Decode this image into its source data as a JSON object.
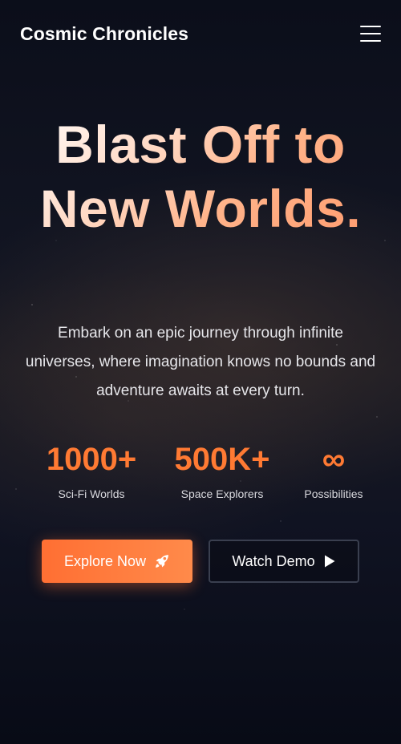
{
  "header": {
    "brand": "Cosmic Chronicles",
    "menu_icon": "hamburger-menu-icon"
  },
  "hero": {
    "title": "Blast Off to New Worlds.",
    "subtitle": "Embark on an epic journey through infinite universes, where imagination knows no bounds and adventure awaits at every turn."
  },
  "stats": [
    {
      "value": "1000+",
      "label": "Sci-Fi Worlds"
    },
    {
      "value": "500K+",
      "label": "Space Explorers"
    },
    {
      "value": "∞",
      "label": "Possibilities"
    }
  ],
  "actions": {
    "primary_label": "Explore Now",
    "primary_icon": "rocket-icon",
    "secondary_label": "Watch Demo",
    "secondary_icon": "play-icon"
  },
  "colors": {
    "accent": "#ff7a33",
    "background": "#0a0d18",
    "text": "#ffffff"
  }
}
